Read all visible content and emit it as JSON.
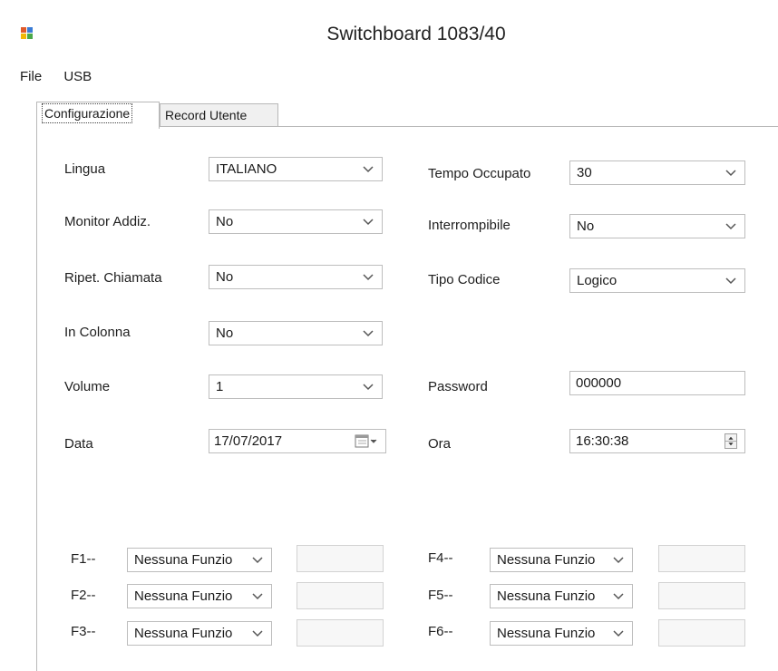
{
  "window": {
    "title": "Switchboard 1083/40"
  },
  "menu": [
    "File",
    "USB"
  ],
  "tabs": [
    "Configurazione",
    "Record Utente"
  ],
  "fields": {
    "lingua": {
      "label": "Lingua",
      "value": "ITALIANO"
    },
    "monitor": {
      "label": "Monitor Addiz.",
      "value": "No"
    },
    "ripet": {
      "label": "Ripet. Chiamata",
      "value": "No"
    },
    "colonna": {
      "label": "In Colonna",
      "value": "No"
    },
    "volume": {
      "label": "Volume",
      "value": "1"
    },
    "data": {
      "label": "Data",
      "value": "17/07/2017"
    },
    "tempo": {
      "label": "Tempo Occupato",
      "value": "30"
    },
    "interr": {
      "label": "Interrompibile",
      "value": "No"
    },
    "tipo": {
      "label": "Tipo Codice",
      "value": "Logico"
    },
    "password": {
      "label": "Password",
      "value": "000000"
    },
    "ora": {
      "label": "Ora",
      "value": "16:30:38"
    }
  },
  "fkeys": [
    {
      "label": "F1--",
      "value": "Nessuna Funzio"
    },
    {
      "label": "F2--",
      "value": "Nessuna Funzio"
    },
    {
      "label": "F3--",
      "value": "Nessuna Funzio"
    },
    {
      "label": "F4--",
      "value": "Nessuna Funzio"
    },
    {
      "label": "F5--",
      "value": "Nessuna Funzio"
    },
    {
      "label": "F6--",
      "value": "Nessuna Funzio"
    }
  ],
  "icons": {
    "app": "app-icon",
    "dropdown": "chevron-down-icon",
    "calendar": "calendar-icon",
    "spinner": "spinner-icon"
  }
}
